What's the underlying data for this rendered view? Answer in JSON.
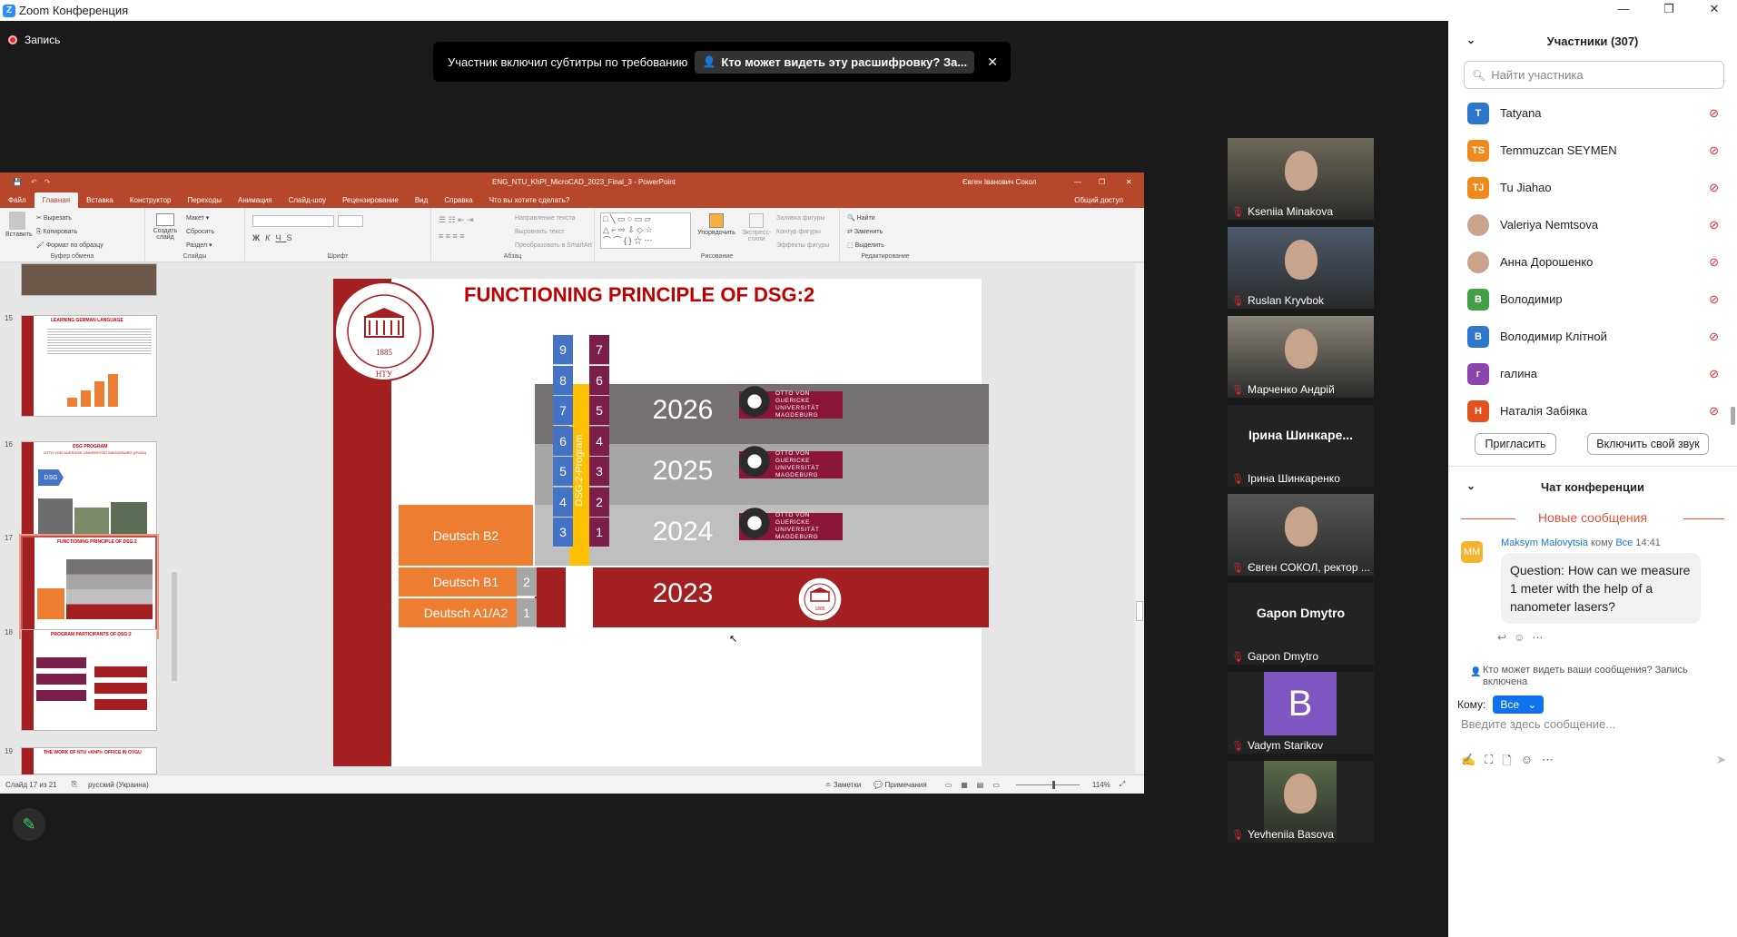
{
  "window": {
    "app_icon": "Z",
    "title": "Zoom Конференция",
    "minimize": "—",
    "restore": "❐",
    "close": "✕"
  },
  "recording": {
    "label": "Запись"
  },
  "notice": {
    "text": "Участник включил субтитры по требованию",
    "link": "Кто может видеть эту расшифровку? За...",
    "close": "✕"
  },
  "ppt": {
    "title": "ENG_NTU_KhPI_MicroCAD_2023_Final_3 - PowerPoint",
    "user": "Євген Іванович Сокол",
    "tabs": [
      "Файл",
      "Главная",
      "Вставка",
      "Конструктор",
      "Переходы",
      "Анимация",
      "Слайд-шоу",
      "Рецензирование",
      "Вид",
      "Справка",
      "Что вы хотите сделать?"
    ],
    "share": "Общий доступ",
    "ribbon": {
      "clipboard": {
        "paste": "Вставить",
        "cut": "Вырезать",
        "copy": "Копировать",
        "format": "Формат по образцу",
        "name": "Буфер обмена"
      },
      "slides": {
        "new": "Создать слайд",
        "layout": "Макет",
        "reset": "Сбросить",
        "section": "Раздел",
        "name": "Слайды"
      },
      "font": {
        "name": "Шрифт",
        "bold": "Ж",
        "italic": "К",
        "underline": "Ч",
        "strike": "S"
      },
      "paragraph": {
        "name": "Абзац",
        "dir": "Направление текста",
        "align": "Выровнять текст",
        "smart": "Преобразовать в SmartArt"
      },
      "drawing": {
        "name": "Рисование",
        "arrange": "Упорядочить",
        "styles": "Экспресс-стили",
        "fill": "Заливка фигуры",
        "outline": "Контур фигуры",
        "effects": "Эффекты фигуры"
      },
      "editing": {
        "name": "Редактирование",
        "find": "Найти",
        "replace": "Заменить",
        "select": "Выделить"
      }
    },
    "thumbs": [
      {
        "num": "15",
        "title": "LEARNING GERMAN LANGUAGE"
      },
      {
        "num": "16",
        "title": "DSG PROGRAM",
        "sub": "OTTO VON GUERICKE UNIVERSITÄT MAGDEBURG (OVGU)",
        "tag": "DSG"
      },
      {
        "num": "17",
        "title": "FUNCTIONING PRINCIPLE OF DSG:2"
      },
      {
        "num": "18",
        "title": "PROGRAM PARTICIPANTS OF DSG:2"
      },
      {
        "num": "19",
        "title": "THE WORK OF NTU «KhPI» OFFICE IN OVGU"
      }
    ],
    "slide": {
      "title": "FUNCTIONING PRINCIPLE OF DSG:2",
      "logo_year": "1885",
      "logo_abbr": "НТУ",
      "logo_ring": "ХАРКІВСЬКИЙ ПОЛІТЕХНІЧНИЙ ІНСТИТУТ",
      "program": "DSG:2-Program",
      "rows": [
        {
          "year": "2026",
          "left": [
            "8",
            "6"
          ],
          "top": [
            "9",
            "7"
          ],
          "partner": "OTTO VON GUERICKE UNIVERSITÄT MAGDEBURG"
        },
        {
          "year": "2025",
          "left": [
            "7",
            "5"
          ],
          "left2": [
            "6",
            "4"
          ],
          "partner": "OTTO VON GUERICKE UNIVERSITÄT MAGDEBURG"
        },
        {
          "year": "2024",
          "left": [
            "5",
            "3"
          ],
          "left2": [
            "4",
            "2"
          ],
          "partner": "OTTO VON GUERICKE UNIVERSITÄT MAGDEBURG"
        },
        {
          "year": "2023",
          "left": [
            "3",
            "1"
          ],
          "partner": "1885"
        }
      ],
      "col_blue": [
        "9",
        "8",
        "7",
        "6",
        "5",
        "4",
        "3"
      ],
      "col_maroon": [
        "7",
        "6",
        "5",
        "4",
        "3",
        "2",
        "1"
      ],
      "col_grey": [
        "2",
        "1"
      ],
      "levels": [
        "Deutsch B2",
        "Deutsch B1",
        "Deutsch A1/A2"
      ]
    },
    "status": {
      "slide": "Слайд 17 из 21",
      "lang": "русский (Украина)",
      "notes": "Заметки",
      "comments": "Примечания",
      "zoom": "114%"
    }
  },
  "tiles": [
    {
      "name": "Kseniia Minakova",
      "type": "video"
    },
    {
      "name": "Ruslan Kryvbok",
      "type": "video"
    },
    {
      "name": "Марченко Андрій",
      "type": "video"
    },
    {
      "name": "Ірина Шинкаренко",
      "big": "Ірина  Шинкаре...",
      "type": "name"
    },
    {
      "name": "Євген СОКОЛ, ректор ...",
      "type": "video",
      "active": true
    },
    {
      "name": "Gapon Dmytro",
      "big": "Gapon Dmytro",
      "type": "name"
    },
    {
      "name": "Vadym Starikov",
      "letter": "B",
      "type": "letter"
    },
    {
      "name": "Yevheniia Basova",
      "type": "video"
    }
  ],
  "participants": {
    "title": "Участники (307)",
    "search_placeholder": "Найти участника",
    "list": [
      {
        "initials": "T",
        "name": "Tatyana",
        "color": "#2e77cf"
      },
      {
        "initials": "TS",
        "name": "Temmuzcan SEYMEN",
        "color": "#f08a1d"
      },
      {
        "initials": "TJ",
        "name": "Tu Jiahao",
        "color": "#f08a1d"
      },
      {
        "initials": "",
        "name": "Valeriya Nemtsova",
        "color": "#c9a38c"
      },
      {
        "initials": "",
        "name": "Анна Дорошенко",
        "color": "#c9a38c"
      },
      {
        "initials": "В",
        "name": "Володимир",
        "color": "#43a047"
      },
      {
        "initials": "В",
        "name": "Володимир Клітной",
        "color": "#2e77cf"
      },
      {
        "initials": "г",
        "name": "галина",
        "color": "#8e44ad"
      },
      {
        "initials": "Н",
        "name": "Наталія Забіяка",
        "color": "#e0531d"
      }
    ],
    "invite": "Пригласить",
    "unmute": "Включить свой звук"
  },
  "chat": {
    "title": "Чат конференции",
    "new_messages": "Новые сообщения",
    "message": {
      "avatar": "MM",
      "sender": "Maksym Malovytsia",
      "to": "кому",
      "to_target": "Все",
      "time": "14:41",
      "text": "Question: How can we measure 1 meter with the help of a nanometer lasers?"
    },
    "privacy": "Кто может видеть ваши сообщения? Запись включена",
    "to_label": "Кому:",
    "to_value": "Все",
    "input_placeholder": "Введите здесь сообщение..."
  },
  "colors": {
    "ppt_red": "#b7472a",
    "slide_red": "#a41f22",
    "orange": "#ed7d31",
    "blue": "#4472c4",
    "maroon": "#7b1e4a",
    "yellow": "#ffc000",
    "grey_dark": "#767171",
    "grey_mid": "#a6a6a6",
    "grey_light": "#bfbfbf",
    "zoom_blue": "#2d8cff"
  }
}
